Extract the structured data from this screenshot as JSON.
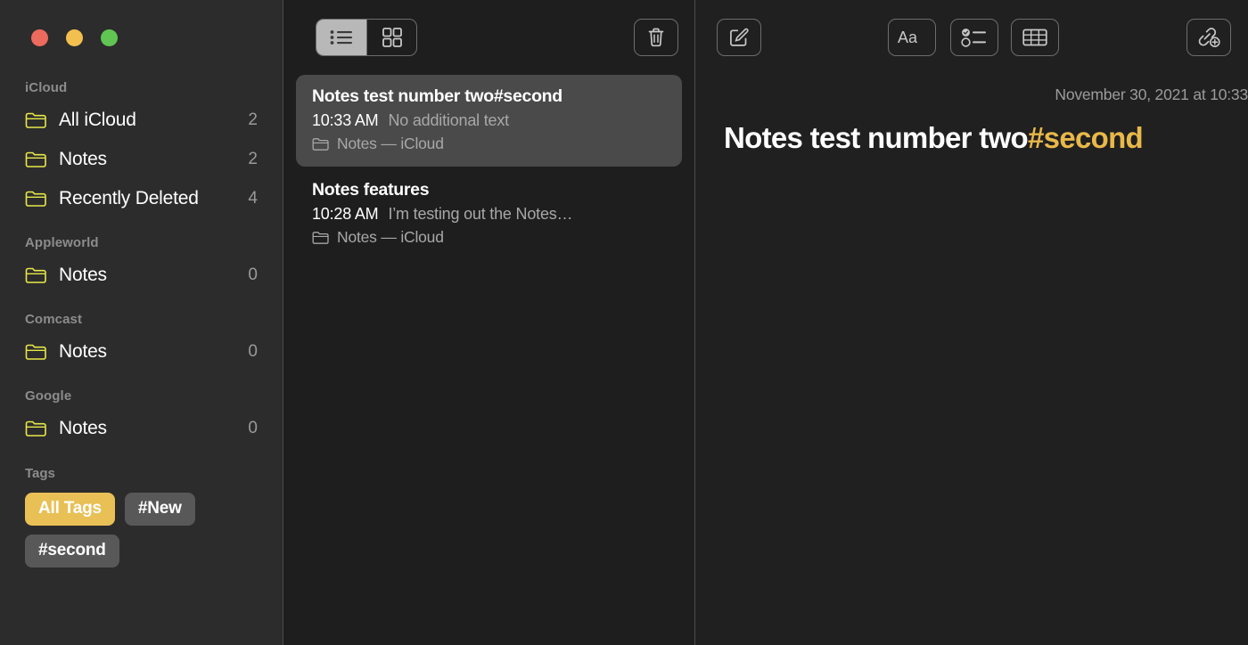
{
  "window": {
    "traffic_lights": [
      {
        "name": "close",
        "color": "#ed6a5e"
      },
      {
        "name": "minimize",
        "color": "#f3bf4f"
      },
      {
        "name": "zoom",
        "color": "#61c554"
      }
    ]
  },
  "sidebar": {
    "sections": [
      {
        "header": "iCloud",
        "items": [
          {
            "label": "All iCloud",
            "count": "2",
            "icon": "folder-icon"
          },
          {
            "label": "Notes",
            "count": "2",
            "icon": "folder-icon"
          },
          {
            "label": "Recently Deleted",
            "count": "4",
            "icon": "folder-icon"
          }
        ]
      },
      {
        "header": "Appleworld",
        "items": [
          {
            "label": "Notes",
            "count": "0",
            "icon": "folder-icon"
          }
        ]
      },
      {
        "header": "Comcast",
        "items": [
          {
            "label": "Notes",
            "count": "0",
            "icon": "folder-icon"
          }
        ]
      },
      {
        "header": "Google",
        "items": [
          {
            "label": "Notes",
            "count": "0",
            "icon": "folder-icon"
          }
        ]
      }
    ],
    "tags": {
      "header": "Tags",
      "pills": [
        {
          "label": "All Tags",
          "selected": true
        },
        {
          "label": "#New",
          "selected": false
        },
        {
          "label": "#second",
          "selected": false
        }
      ]
    }
  },
  "list_panel": {
    "toolbar": {
      "view_list_icon": "list-view-icon",
      "view_gallery_icon": "gallery-view-icon",
      "selected_view": "list",
      "delete_icon": "trash-icon"
    },
    "notes": [
      {
        "title": "Notes test number two#second",
        "time": "10:33 AM",
        "snippet": "No additional text",
        "folder": "Notes — iCloud",
        "selected": true
      },
      {
        "title": "Notes features",
        "time": "10:28 AM",
        "snippet": "I’m testing out the Notes…",
        "folder": "Notes — iCloud",
        "selected": false
      }
    ]
  },
  "editor": {
    "toolbar_icons": [
      "compose-icon",
      "format-text-icon",
      "checklist-icon",
      "table-icon",
      "add-link-icon"
    ],
    "date": "November 30, 2021 at 10:33",
    "title_plain": "Notes test number two",
    "title_tag": "#second",
    "body": ""
  },
  "colors": {
    "sidebar_bg": "#2c2c2c",
    "list_bg": "#1e1e1e",
    "editor_bg": "#202020",
    "folder_yellow": "#e8e84a",
    "tag_accent": "#e9b84a",
    "tag_pill_selected": "#e8c055",
    "tag_pill": "#585858",
    "selected_row": "#4a4a4a",
    "divider": "#4a4a4a"
  }
}
